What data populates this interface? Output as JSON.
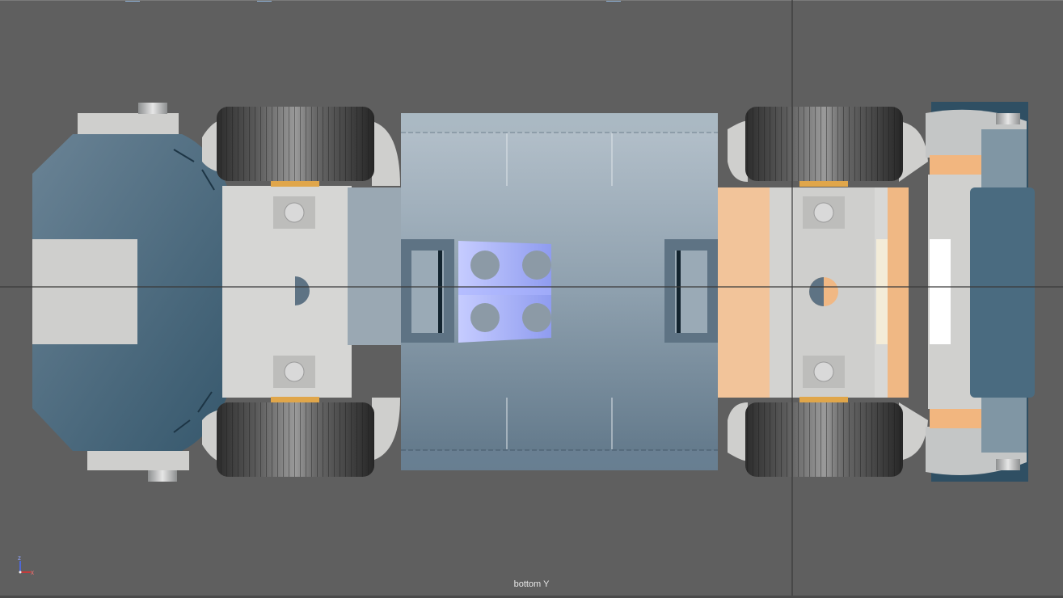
{
  "viewport": {
    "view_label": "bottom Y",
    "background": "#5f5f5f"
  },
  "axis_gizmo": {
    "z_label": "z",
    "x_label": "x",
    "z_color": "#4a6cff",
    "x_color": "#e23030"
  },
  "colors": {
    "body_blue": "#4c6b80",
    "light_gray": "#d4d4d2",
    "metal": "#b8babb",
    "tire": "#3c3c3c",
    "peach": "#f2c49a",
    "selection_blue": "#aab4ff",
    "crosshair": "#3a3a3a"
  }
}
